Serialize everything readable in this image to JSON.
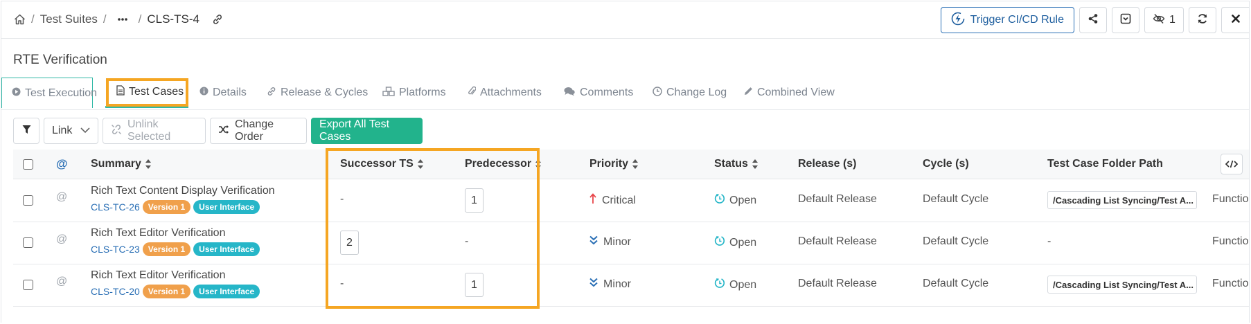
{
  "breadcrumb": {
    "items": [
      "Test Suites",
      "CLS-TS-4"
    ],
    "separator": "/"
  },
  "topbar": {
    "trigger_label": "Trigger CI/CD Rule",
    "watch_count": "1"
  },
  "page": {
    "title": "RTE Verification"
  },
  "tabs": [
    {
      "label": "Test Execution",
      "icon": "play-circle-icon"
    },
    {
      "label": "Test Cases",
      "icon": "document-icon"
    },
    {
      "label": "Details",
      "icon": "info-icon"
    },
    {
      "label": "Release & Cycles",
      "icon": "link-icon"
    },
    {
      "label": "Platforms",
      "icon": "cubes-icon"
    },
    {
      "label": "Attachments",
      "icon": "paperclip-icon"
    },
    {
      "label": "Comments",
      "icon": "comments-icon"
    },
    {
      "label": "Change Log",
      "icon": "clock-icon"
    },
    {
      "label": "Combined View",
      "icon": "pencil-icon"
    }
  ],
  "active_tab": "Test Cases",
  "toolbar": {
    "link_label": "Link",
    "unlink_label": "Unlink Selected",
    "change_order_label": "Change Order",
    "export_label": "Export All Test Cases"
  },
  "table": {
    "columns": {
      "at": "@",
      "summary": "Summary",
      "successor": "Successor TS",
      "predecessor": "Predecessor",
      "priority": "Priority",
      "status": "Status",
      "release": "Release (s)",
      "cycle": "Cycle (s)",
      "folder": "Test Case Folder Path"
    },
    "rows": [
      {
        "summary": "Rich Text Content Display Verification",
        "key": "CLS-TC-26",
        "version": "Version 1",
        "tag": "User Interface",
        "successor": "-",
        "predecessor": "1",
        "priority": "Critical",
        "status": "Open",
        "release": "Default Release",
        "cycle": "Default Cycle",
        "folder": "/Cascading List Syncing/Test A...",
        "extra": "Functio"
      },
      {
        "summary": "Rich Text Editor Verification",
        "key": "CLS-TC-23",
        "version": "Version 1",
        "tag": "User Interface",
        "successor": "2",
        "predecessor": "-",
        "priority": "Minor",
        "status": "Open",
        "release": "Default Release",
        "cycle": "Default Cycle",
        "folder": "-",
        "extra": "Functio"
      },
      {
        "summary": "Rich Text Editor Verification",
        "key": "CLS-TC-20",
        "version": "Version 1",
        "tag": "User Interface",
        "successor": "-",
        "predecessor": "1",
        "priority": "Minor",
        "status": "Open",
        "release": "Default Release",
        "cycle": "Default Cycle",
        "folder": "/Cascading List Syncing/Test A...",
        "extra": "Functio"
      }
    ]
  },
  "colors": {
    "accent_teal": "#2fb8a6",
    "primary_blue": "#2a6fb5",
    "export_green": "#22b38c",
    "highlight_orange": "#f5a623",
    "critical_red": "#e8474b",
    "minor_blue": "#2a6fb5",
    "status_teal": "#26b6c8",
    "version_badge": "#f0a04b",
    "tag_badge": "#26b6c8"
  }
}
